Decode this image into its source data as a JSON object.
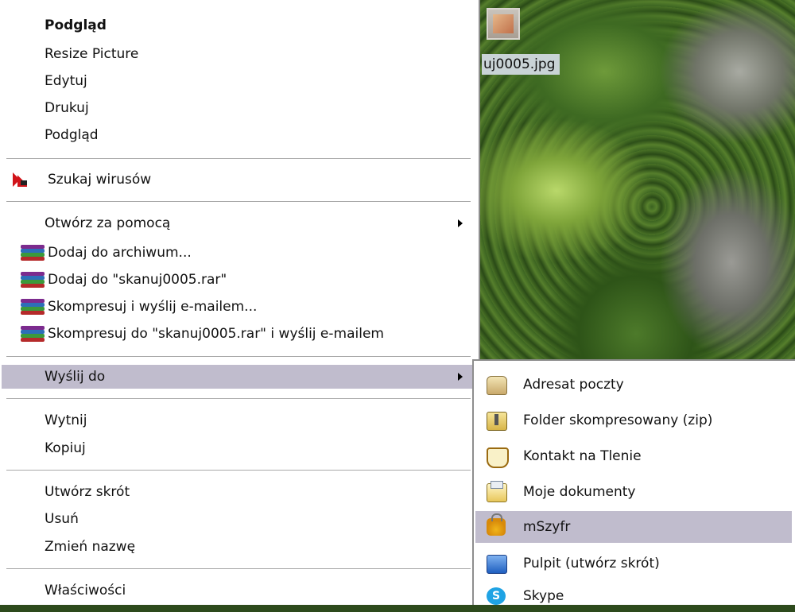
{
  "desktop": {
    "file_label": "uj0005.jpg"
  },
  "menu": {
    "items": [
      {
        "label": "Podgląd"
      },
      {
        "label": "Resize Picture"
      },
      {
        "label": "Edytuj"
      },
      {
        "label": "Drukuj"
      },
      {
        "label": "Podgląd"
      },
      {
        "label": "Szukaj wirusów"
      },
      {
        "label": "Otwórz za pomocą"
      },
      {
        "label": "Dodaj do archiwum..."
      },
      {
        "label": "Dodaj do \"skanuj0005.rar\""
      },
      {
        "label": "Skompresuj i wyślij e-mailem..."
      },
      {
        "label": "Skompresuj do \"skanuj0005.rar\" i wyślij e-mailem"
      },
      {
        "label": "Wyślij do"
      },
      {
        "label": "Wytnij"
      },
      {
        "label": "Kopiuj"
      },
      {
        "label": "Utwórz skrót"
      },
      {
        "label": "Usuń"
      },
      {
        "label": "Zmień nazwę"
      },
      {
        "label": "Właściwości"
      }
    ]
  },
  "submenu": {
    "items": [
      {
        "label": "Adresat poczty",
        "icon": "mail-recipient-icon"
      },
      {
        "label": "Folder skompresowany (zip)",
        "icon": "zip-folder-icon"
      },
      {
        "label": "Kontakt na Tlenie",
        "icon": "tlen-contact-icon"
      },
      {
        "label": "Moje dokumenty",
        "icon": "my-documents-icon"
      },
      {
        "label": "mSzyfr",
        "icon": "lock-icon"
      },
      {
        "label": "Pulpit (utwórz skrót)",
        "icon": "desktop-shortcut-icon"
      },
      {
        "label": "Skype",
        "icon": "skype-icon"
      }
    ]
  },
  "colors": {
    "highlight": "#c0bccd",
    "menu_bg": "#ffffff",
    "kaspersky_red": "#d1141a"
  }
}
